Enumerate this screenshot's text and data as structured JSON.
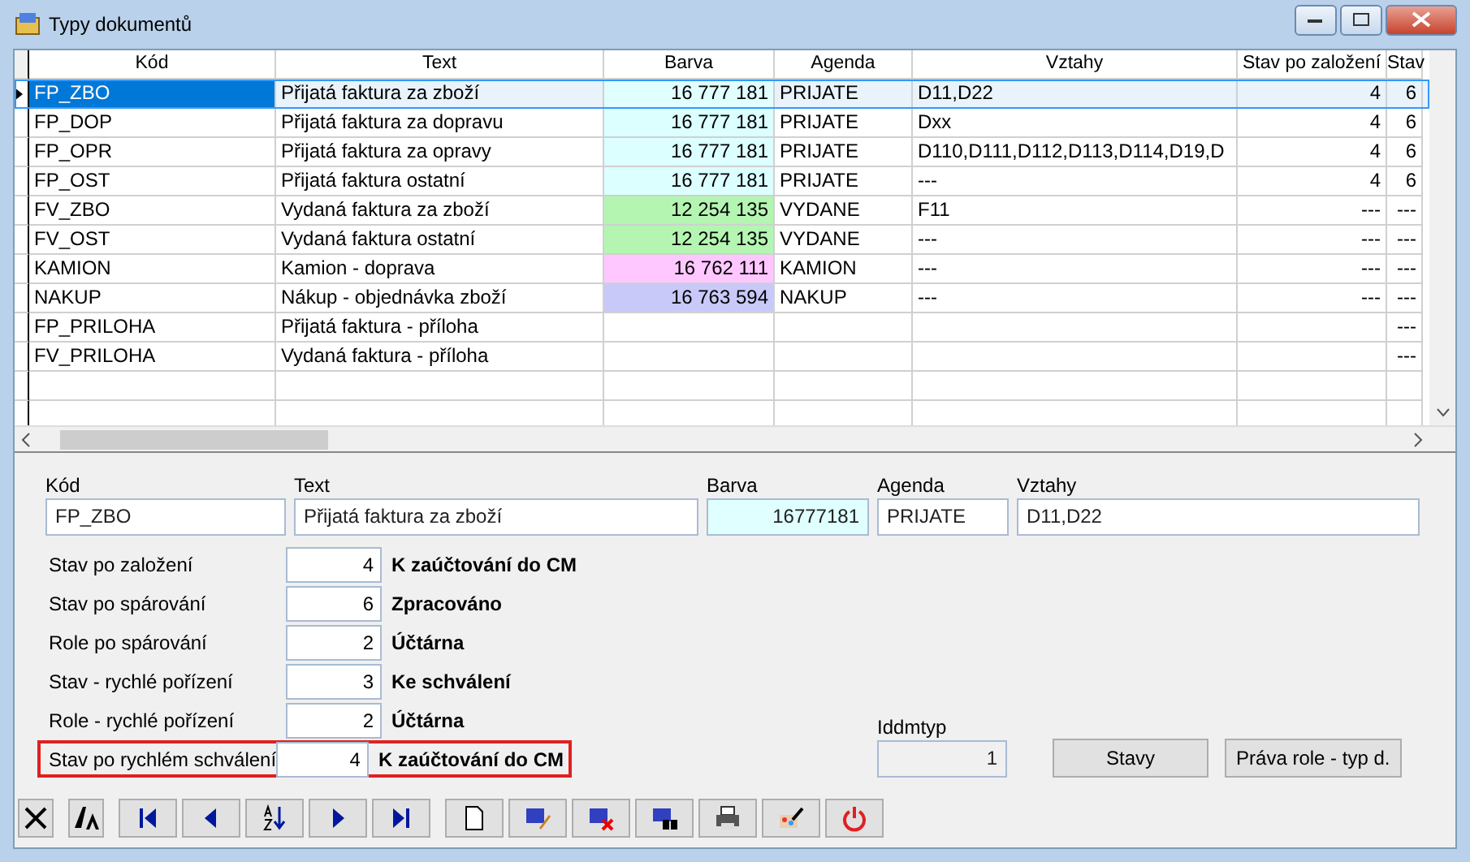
{
  "window": {
    "title": "Typy dokumentů"
  },
  "table": {
    "columns": [
      "Kód",
      "Text",
      "Barva",
      "Agenda",
      "Vztahy",
      "Stav po založení",
      "Stav"
    ],
    "rows": [
      {
        "selected": true,
        "cells": [
          "FP_ZBO",
          "Přijatá faktura za zboží",
          "16 777 181",
          "PRIJATE",
          "D11,D22",
          "4",
          "6"
        ],
        "color": "#e0ffff"
      },
      {
        "selected": false,
        "cells": [
          "FP_DOP",
          "Přijatá faktura za dopravu",
          "16 777 181",
          "PRIJATE",
          "Dxx",
          "4",
          "6"
        ],
        "color": "#dcffff"
      },
      {
        "selected": false,
        "cells": [
          "FP_OPR",
          "Přijatá faktura za opravy",
          "16 777 181",
          "PRIJATE",
          "D110,D111,D112,D113,D114,D19,D",
          "4",
          "6"
        ],
        "color": "#dcffff"
      },
      {
        "selected": false,
        "cells": [
          "FP_OST",
          "Přijatá faktura ostatní",
          "16 777 181",
          "PRIJATE",
          "---",
          "4",
          "6"
        ],
        "color": "#dcffff"
      },
      {
        "selected": false,
        "cells": [
          "FV_ZBO",
          "Vydaná faktura za zboží",
          "12 254 135",
          "VYDANE",
          "F11",
          "---",
          "---"
        ],
        "color": "#b4f5b2"
      },
      {
        "selected": false,
        "cells": [
          "FV_OST",
          "Vydaná faktura ostatní",
          "12 254 135",
          "VYDANE",
          "---",
          "---",
          "---"
        ],
        "color": "#b4f5b2"
      },
      {
        "selected": false,
        "cells": [
          "KAMION",
          "Kamion - doprava",
          "16 762 111",
          "KAMION",
          "---",
          "---",
          "---"
        ],
        "color": "#ffc7ff"
      },
      {
        "selected": false,
        "cells": [
          "NAKUP",
          "Nákup - objednávka zboží",
          "16 763 594",
          "NAKUP",
          "---",
          "---",
          "---"
        ],
        "color": "#c9c9f9"
      },
      {
        "selected": false,
        "cells": [
          "FP_PRILOHA",
          "Přijatá faktura - příloha",
          "",
          "",
          "",
          "",
          "---"
        ]
      },
      {
        "selected": false,
        "cells": [
          "FV_PRILOHA",
          "Vydaná faktura - příloha",
          "",
          "",
          "",
          "",
          "---"
        ]
      }
    ]
  },
  "detail": {
    "fields": [
      {
        "label": "Kód",
        "value": "FP_ZBO"
      },
      {
        "label": "Text",
        "value": "Přijatá faktura za zboží"
      },
      {
        "label": "Barva",
        "value": "16777181",
        "color": "#e0ffff"
      },
      {
        "label": "Agenda",
        "value": "PRIJATE"
      },
      {
        "label": "Vztahy",
        "value": "D11,D22"
      }
    ],
    "states": [
      {
        "label": "Stav po založení",
        "value": "4",
        "description": "K zaúčtování do CM",
        "highlighted": false
      },
      {
        "label": "Stav po spárování",
        "value": "6",
        "description": "Zpracováno",
        "highlighted": false
      },
      {
        "label": "Role po spárování",
        "value": "2",
        "description": "Účtárna",
        "highlighted": false
      },
      {
        "label": "Stav - rychlé pořízení",
        "value": "3",
        "description": "Ke schválení",
        "highlighted": false
      },
      {
        "label": "Role - rychlé pořízení",
        "value": "2",
        "description": "Účtárna",
        "highlighted": false
      },
      {
        "label": "Stav po rychlém schválení",
        "value": "4",
        "description": "K zaúčtování do CM",
        "highlighted": true
      }
    ],
    "iddmtyp": {
      "label": "Iddmtyp",
      "value": "1"
    },
    "buttons": [
      "Stavy",
      "Práva role - typ d."
    ]
  }
}
